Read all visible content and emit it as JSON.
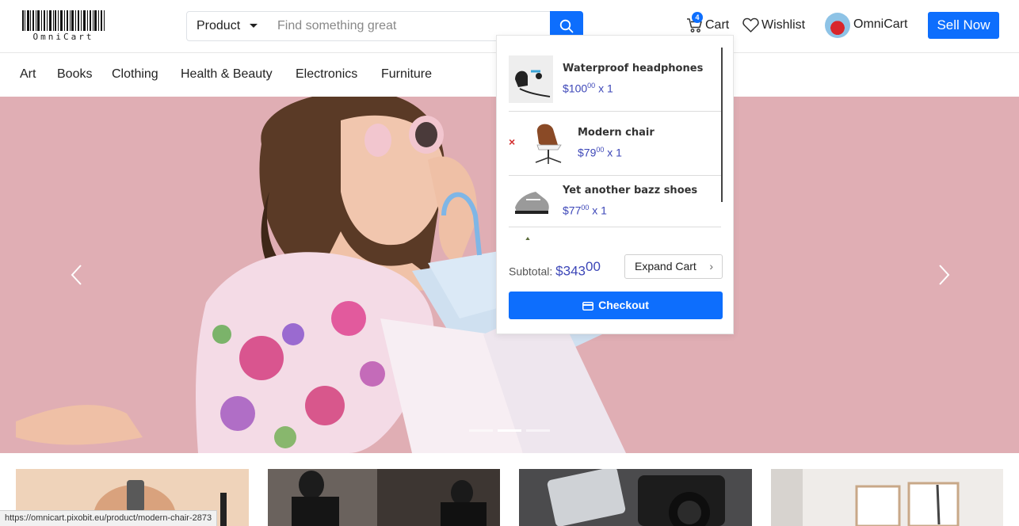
{
  "brand": {
    "logo_text": "OmniCart"
  },
  "search": {
    "category": "Product",
    "placeholder": "Find something great"
  },
  "header": {
    "cart_label": "Cart",
    "cart_count": "4",
    "wishlist_label": "Wishlist",
    "user_name": "OmniCart",
    "sell_label": "Sell Now"
  },
  "categories": [
    "Art",
    "Books",
    "Clothing",
    "Health & Beauty",
    "Electronics",
    "Furniture"
  ],
  "cart": {
    "items": [
      {
        "name": "Waterproof headphones",
        "price": "$100",
        "cents": "00",
        "qty": "x 1"
      },
      {
        "name": "Modern chair",
        "price": "$79",
        "cents": "00",
        "qty": "x 1",
        "remove": "×"
      },
      {
        "name": "Yet another bazz shoes",
        "price": "$77",
        "cents": "00",
        "qty": "x 1"
      }
    ],
    "subtotal_label": "Subtotal:",
    "subtotal": "$343",
    "subtotal_cents": "00",
    "expand_label": "Expand Cart",
    "checkout_label": "Checkout"
  },
  "carousel": {
    "slide_count": 3,
    "active_index": 1
  },
  "status_url": "https://omnicart.pixobit.eu/product/modern-chair-2873",
  "colors": {
    "primary": "#0d6efd",
    "price": "#3d47b8",
    "hero_bg": "#e0aeb4",
    "remove": "#d32f2f"
  }
}
